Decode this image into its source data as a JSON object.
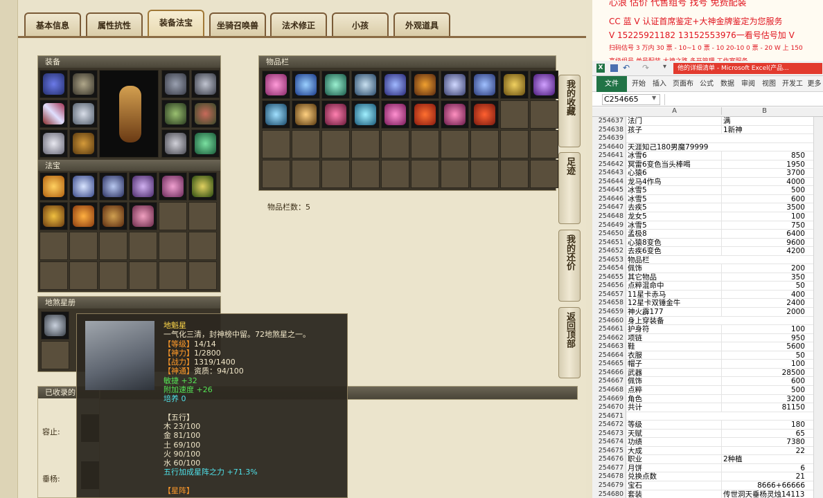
{
  "tabs": [
    "基本信息",
    "属性抗性",
    "装备法宝",
    "坐骑召唤兽",
    "法术修正",
    "小孩",
    "外观道具"
  ],
  "sections": {
    "equipment": "装备",
    "treasure": "法宝",
    "stars": "地煞星册",
    "inventory": "物品栏",
    "collected": "已收录的",
    "inventory_count": "物品栏数：5"
  },
  "left_labels": {
    "a": "容止:",
    "b": "垂杨:"
  },
  "side_buttons": [
    "我的收藏",
    "足迹",
    "我的还价",
    "返回顶部"
  ],
  "tooltip": {
    "name": "地魁星",
    "desc": "一气化三清，封神榜中留。72地煞星之一。",
    "level_label": "【等级】",
    "level_value": "14/14",
    "power_label": "【神力】",
    "power_value": "1/2800",
    "combat_label": "【战力】",
    "combat_value": "1319/1400",
    "talent_label": "【神通】",
    "talent_value": "资质：94/100",
    "agility": "敏捷 +32",
    "speed": "附加速度 +26",
    "cultivate": "培养 0",
    "wuxing_title": "【五行】",
    "wood": "木 23/100",
    "metal": "金 81/100",
    "earth": "土 69/100",
    "fire": "火 90/100",
    "water": "水 60/100",
    "bonus": "五行加成星阵之力 +71.3%",
    "star_title": "【星阵】"
  },
  "ad": {
    "line0": "心浪 估价 代售组号  找号  免费配装",
    "line1": "CC 蓝 V 认证首席鉴定+大神金牌鉴定为您服务",
    "line2": "V 15225921182      13152553976一看号估号加 V",
    "line3": "扫码估号 3 万内 30 票 - 10~1 0 票 - 10 20-10 0 票 - 20 W 上 150",
    "line4": "高级组号 单号配装 大神之路 多开管理 工作室服务"
  },
  "excel": {
    "title": "他的详细清单 - Microsoft Excel(产品...",
    "ribbon_tabs": [
      "文件",
      "开始",
      "插入",
      "页面布",
      "公式",
      "数据",
      "审阅",
      "视图",
      "开发工",
      "更多"
    ],
    "name_box": "C254665",
    "col_a": "A",
    "col_b": "B",
    "rows": [
      [
        "254637",
        "法门",
        "满"
      ],
      [
        "254638",
        "孩子",
        "1新神"
      ],
      [
        "254639",
        "",
        ""
      ],
      [
        "254640",
        "天涯知己180男魔79999",
        ""
      ],
      [
        "254641",
        "冰雪6",
        "850"
      ],
      [
        "254642",
        "冥雷6变色当头棒喝",
        "1950"
      ],
      [
        "254643",
        "心猿6",
        "3700"
      ],
      [
        "254644",
        "龙马4作鸟",
        "4000"
      ],
      [
        "254645",
        "冰雪5",
        "500"
      ],
      [
        "254646",
        "冰雪5",
        "600"
      ],
      [
        "254647",
        "去疾5",
        "3500"
      ],
      [
        "254648",
        "龙女5",
        "100"
      ],
      [
        "254649",
        "冰雪5",
        "750"
      ],
      [
        "254650",
        "孟极8",
        "6400"
      ],
      [
        "254651",
        "心猿8变色",
        "9600"
      ],
      [
        "254652",
        "去疾6变色",
        "4200"
      ],
      [
        "254653",
        "物品栏",
        ""
      ],
      [
        "254654",
        "佩饰",
        "200"
      ],
      [
        "254655",
        "其它物品",
        "350"
      ],
      [
        "254656",
        "点粹混命中",
        "50"
      ],
      [
        "254657",
        "11星卡赤马",
        "400"
      ],
      [
        "254658",
        "12星卡双锤金牛",
        "2400"
      ],
      [
        "254659",
        "神火霹177",
        "2000"
      ],
      [
        "254660",
        "身上穿装备",
        ""
      ],
      [
        "254661",
        "护身符",
        "100"
      ],
      [
        "254662",
        "项链",
        "950"
      ],
      [
        "254663",
        "鞋",
        "5600"
      ],
      [
        "254664",
        "衣服",
        "50"
      ],
      [
        "254665",
        "帽子",
        "100"
      ],
      [
        "254666",
        "武器",
        "28500"
      ],
      [
        "254667",
        "佩饰",
        "600"
      ],
      [
        "254668",
        "点粹",
        "500"
      ],
      [
        "254669",
        "角色",
        "3200"
      ],
      [
        "254670",
        "共计",
        "81150"
      ],
      [
        "254671",
        "",
        ""
      ],
      [
        "254672",
        "等级",
        "180"
      ],
      [
        "254673",
        "天赋",
        "65"
      ],
      [
        "254674",
        "功绩",
        "7380"
      ],
      [
        "254675",
        "大成",
        "22"
      ],
      [
        "254676",
        "职业",
        "2种植"
      ],
      [
        "254677",
        "月饼",
        "6"
      ],
      [
        "254678",
        "兑换点数",
        "21"
      ],
      [
        "254679",
        "宝石",
        "8666+66666"
      ],
      [
        "254680",
        "套装",
        "传世洞天垂杨灵烛14113"
      ]
    ]
  },
  "colors": {
    "tab_border": "#7a5a36",
    "tooltip_yellow": "#ffd84a",
    "tooltip_orange": "#ff9a2a",
    "tooltip_green": "#55e455",
    "tooltip_cyan": "#4fe0e8",
    "excel_green": "#217346",
    "ad_red": "#e0141e"
  }
}
